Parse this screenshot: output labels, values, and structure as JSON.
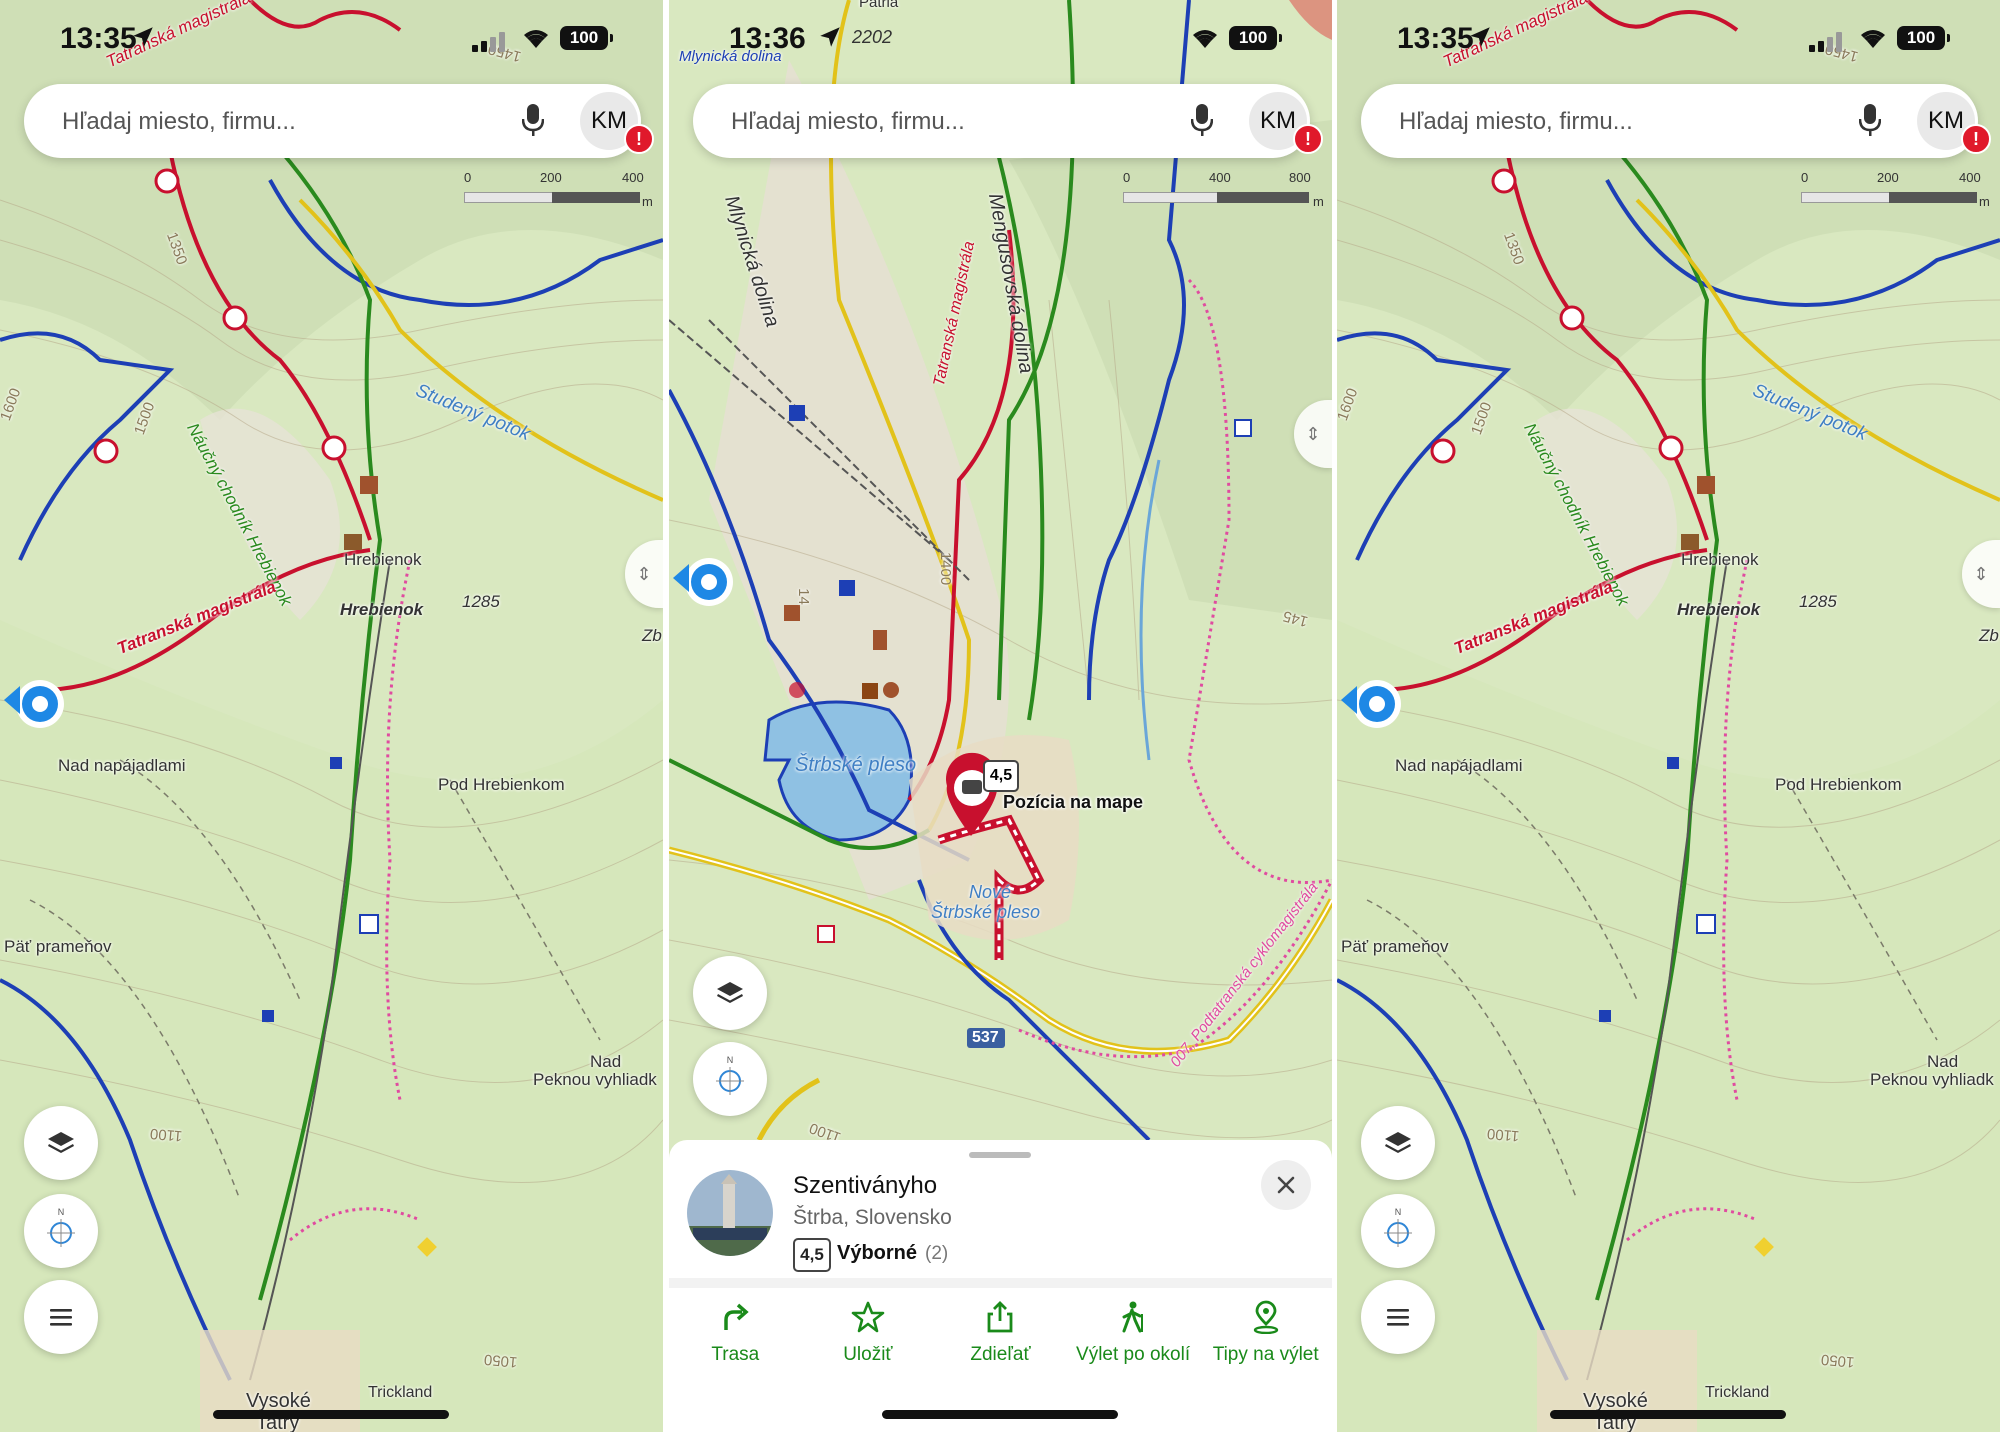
{
  "panels": [
    {
      "status": {
        "time": "13:35",
        "altitude": "",
        "battery": "100"
      },
      "search": {
        "placeholder": "Hľadaj miesto, firmu...",
        "avatar": "KM",
        "badge": "!"
      },
      "scale": {
        "ticks": [
          "0",
          "200",
          "400"
        ],
        "unit": "m"
      },
      "labels": {
        "magistrala_top": "Tatranská magistrála",
        "naucny": "Náučný chodník Hrebienok",
        "studeny": "Studený potok",
        "magistrala": "Tatranská magistrála",
        "hrebienok1": "Hrebienok",
        "hrebienok2": "Hrebienok",
        "elev1285": "1285",
        "nad_napajadlami": "Nad napájadlami",
        "pod_hrebienkom": "Pod Hrebienkom",
        "pat_pramenov": "Päť prameňov",
        "nad_peknou": "Nad",
        "nad_peknou2": "Peknou vyhliadk",
        "vysoke": "Vysoké",
        "tatry": "Tatry",
        "tricklandia": "Trickland",
        "c1350": "1350",
        "c1500": "1500",
        "c1600": "1600",
        "c1100": "1100",
        "c1050": "1050",
        "c1450": "1450",
        "zb": "Zb"
      }
    },
    {
      "status": {
        "time": "13:36",
        "altitude": "2202",
        "battery": "100"
      },
      "search": {
        "placeholder": "Hľadaj miesto, firmu...",
        "avatar": "KM",
        "badge": "!"
      },
      "scale": {
        "ticks": [
          "0",
          "400",
          "800"
        ],
        "unit": "m"
      },
      "labels": {
        "mlynicka_top": "Mlynická dolina",
        "patria": "Patria",
        "mlynicka": "Mlynická dolina",
        "magistrala": "Tatranská magistrála",
        "mengusovska": "Mengusovská dolina",
        "strbske": "Štrbské pleso",
        "nove": "Nové",
        "nove2": "Štrbské pleso",
        "cyklomag": "007, Podtatranská cyklomagistrála",
        "road": "537",
        "c1400": "1400",
        "c1450": "145",
        "c14": "14",
        "c1100": "1100",
        "pin_rating": "4,5",
        "pin_label": "Pozícia na mape"
      },
      "sheet": {
        "title": "Szentiványho",
        "subtitle": "Štrba, Slovensko",
        "rating": "4,5",
        "rating_text": "Výborné",
        "rating_count": "(2)",
        "actions": [
          {
            "label": "Trasa",
            "icon": "route-icon"
          },
          {
            "label": "Uložiť",
            "icon": "star-icon"
          },
          {
            "label": "Zdieľať",
            "icon": "share-icon"
          },
          {
            "label": "Výlet po okolí",
            "icon": "hiker-icon"
          },
          {
            "label": "Tipy na výlet",
            "icon": "pin-icon"
          }
        ]
      }
    },
    {
      "status": {
        "time": "13:35",
        "altitude": "",
        "battery": "100"
      },
      "search": {
        "placeholder": "Hľadaj miesto, firmu...",
        "avatar": "KM",
        "badge": "!"
      },
      "scale": {
        "ticks": [
          "0",
          "200",
          "400"
        ],
        "unit": "m"
      },
      "labels": {
        "magistrala_top": "Tatranská magistrála",
        "naucny": "Náučný chodník Hrebienok",
        "studeny": "Studený potok",
        "magistrala": "Tatranská magistrála",
        "hrebienok1": "Hrebienok",
        "hrebienok2": "Hrebienok",
        "elev1285": "1285",
        "nad_napajadlami": "Nad napájadlami",
        "pod_hrebienkom": "Pod Hrebienkom",
        "pat_pramenov": "Päť prameňov",
        "nad_peknou": "Nad",
        "nad_peknou2": "Peknou vyhliadk",
        "vysoke": "Vysoké",
        "tatry": "Tatry",
        "tricklandia": "Trickland",
        "c1350": "1350",
        "c1500": "1500",
        "c1600": "1600",
        "c1100": "1100",
        "c1050": "1050",
        "c1450": "1450",
        "zb": "Zb"
      }
    }
  ],
  "colors": {
    "map_bg": "#d9e8c0",
    "trail_red": "#c8102e",
    "trail_blue": "#1d3fb5",
    "trail_green": "#2a8a1e",
    "trail_yellow": "#e2c21a",
    "water": "#8fc1e3",
    "accent_green": "#1a8a1a",
    "location_blue": "#1e88e5",
    "badge_red": "#e0192b"
  }
}
